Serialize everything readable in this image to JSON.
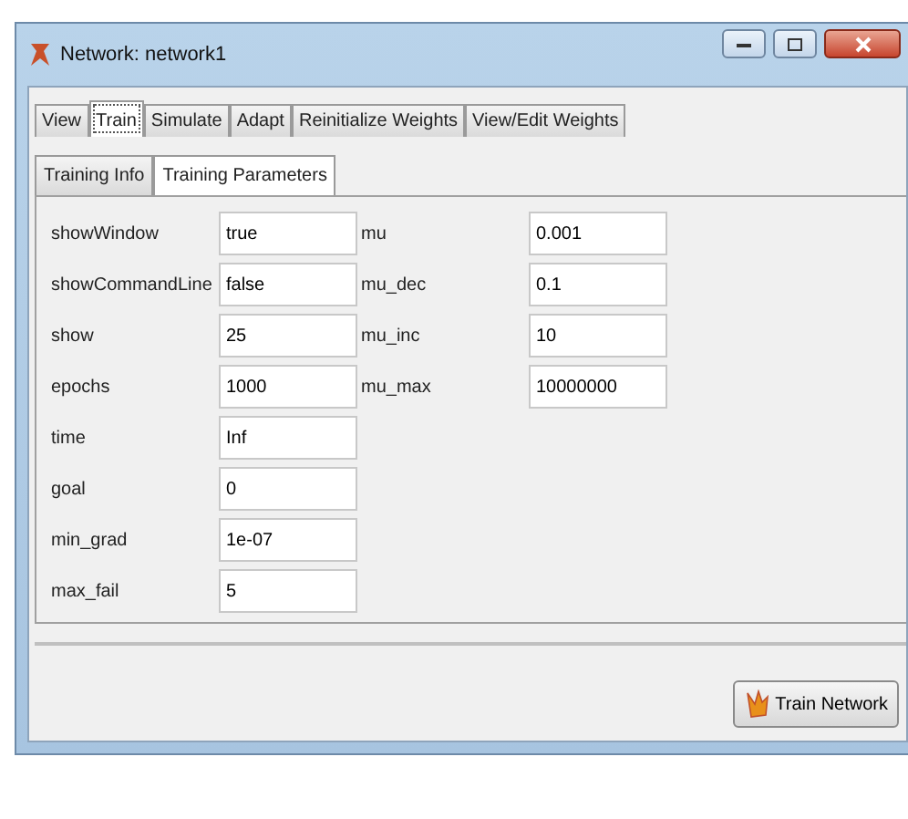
{
  "window": {
    "title": "Network: network1"
  },
  "tabs": [
    {
      "label": "View",
      "selected": false
    },
    {
      "label": "Train",
      "selected": true
    },
    {
      "label": "Simulate",
      "selected": false
    },
    {
      "label": "Adapt",
      "selected": false
    },
    {
      "label": "Reinitialize Weights",
      "selected": false
    },
    {
      "label": "View/Edit Weights",
      "selected": false
    }
  ],
  "subtabs": [
    {
      "label": "Training Info",
      "selected": false
    },
    {
      "label": "Training Parameters",
      "selected": true
    }
  ],
  "parameters_left": [
    {
      "label": "showWindow",
      "value": "true"
    },
    {
      "label": "showCommandLine",
      "value": "false"
    },
    {
      "label": "show",
      "value": "25"
    },
    {
      "label": "epochs",
      "value": "1000"
    },
    {
      "label": "time",
      "value": "Inf"
    },
    {
      "label": "goal",
      "value": "0"
    },
    {
      "label": "min_grad",
      "value": "1e-07"
    },
    {
      "label": "max_fail",
      "value": "5"
    }
  ],
  "parameters_right": [
    {
      "label": "mu",
      "value": "0.001"
    },
    {
      "label": "mu_dec",
      "value": "0.1"
    },
    {
      "label": "mu_inc",
      "value": "10"
    },
    {
      "label": "mu_max",
      "value": "10000000"
    }
  ],
  "train_button": {
    "label": "Train Network"
  }
}
